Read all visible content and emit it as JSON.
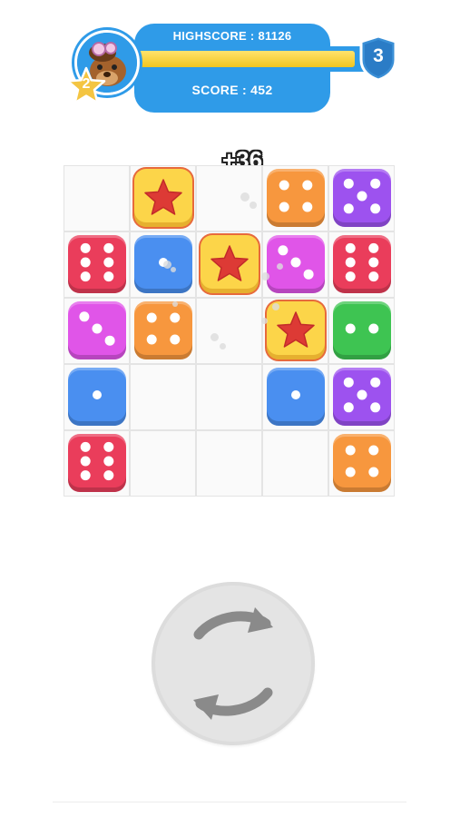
{
  "hud": {
    "highscore_label": "HIGHSCORE : 81126",
    "score_label": "SCORE : 452",
    "progress_fraction": 0.95,
    "level": "3",
    "stars": "2"
  },
  "popup": {
    "points": "+36"
  },
  "colors": {
    "red": "#ea3d5b",
    "blue": "#4a8ff0",
    "pink": "#e055e8",
    "orange": "#f7973e",
    "purple": "#9d52ef",
    "green": "#3ec452",
    "yellow": "#fcd549",
    "star": "#dd3a35",
    "hud_blue": "#2f9be8"
  },
  "board": {
    "rows": 5,
    "cols": 5,
    "cells": [
      [
        null,
        {
          "color": "yellow",
          "pips": "star"
        },
        null,
        {
          "color": "orange",
          "pips": 4
        },
        {
          "color": "purple",
          "pips": 5
        }
      ],
      [
        {
          "color": "red",
          "pips": 6
        },
        {
          "color": "blue",
          "pips": 1
        },
        {
          "color": "yellow",
          "pips": "star"
        },
        {
          "color": "pink",
          "pips": 3
        },
        {
          "color": "red",
          "pips": 6
        }
      ],
      [
        {
          "color": "pink",
          "pips": 3
        },
        {
          "color": "orange",
          "pips": 4
        },
        null,
        {
          "color": "yellow",
          "pips": "star"
        },
        {
          "color": "green",
          "pips": 2
        }
      ],
      [
        {
          "color": "blue",
          "pips": 1
        },
        null,
        null,
        {
          "color": "blue",
          "pips": 1
        },
        {
          "color": "purple",
          "pips": 5
        }
      ],
      [
        {
          "color": "red",
          "pips": 6
        },
        null,
        null,
        null,
        {
          "color": "orange",
          "pips": 4
        }
      ]
    ]
  },
  "controls": {
    "rotate_icon": "rotate-arrows-icon"
  }
}
